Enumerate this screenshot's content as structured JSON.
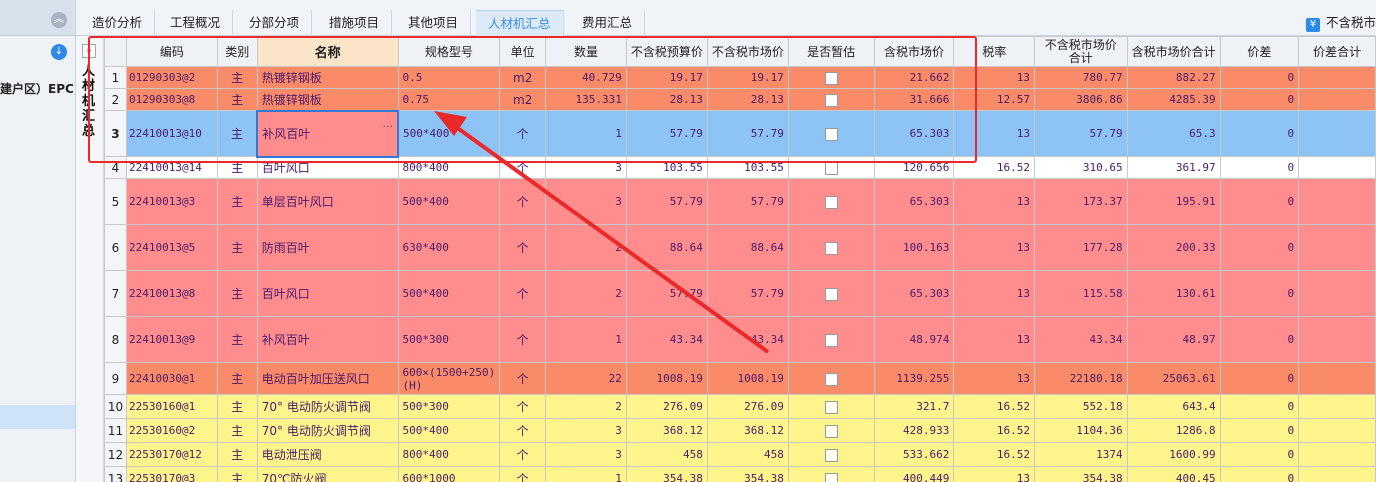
{
  "left": {
    "project_label": "建户区）EPC"
  },
  "tabs": [
    {
      "label": "造价分析"
    },
    {
      "label": "工程概况"
    },
    {
      "label": "分部分项"
    },
    {
      "label": "措施项目"
    },
    {
      "label": "其他项目"
    },
    {
      "label": "人材机汇总"
    },
    {
      "label": "费用汇总"
    }
  ],
  "tax_toggle_label": "不含税市",
  "side_label": "人材机汇总",
  "columns": [
    "编码",
    "类别",
    "名称",
    "规格型号",
    "单位",
    "数量",
    "不含税预算价",
    "不含税市场价",
    "是否暂估",
    "含税市场价",
    "税率",
    "不含税市场价合计",
    "含税市场价合计",
    "价差",
    "价差合计"
  ],
  "rows": [
    {
      "idx": "1",
      "code": "01290303@2",
      "type": "主",
      "name": "热镀锌钢板",
      "spec": "0.5",
      "unit": "m2",
      "qty": "40.729",
      "budget": "19.17",
      "market": "19.17",
      "tax_market": "21.662",
      "rate": "13",
      "total_ex": "780.77",
      "total_inc": "882.27",
      "diff": "0"
    },
    {
      "idx": "2",
      "code": "01290303@8",
      "type": "主",
      "name": "热镀锌钢板",
      "spec": "0.75",
      "unit": "m2",
      "qty": "135.331",
      "budget": "28.13",
      "market": "28.13",
      "tax_market": "31.666",
      "rate": "12.57",
      "total_ex": "3806.86",
      "total_inc": "4285.39",
      "diff": "0"
    },
    {
      "idx": "3",
      "code": "22410013@10",
      "type": "主",
      "name": "补风百叶",
      "spec": "500*400",
      "unit": "个",
      "qty": "1",
      "budget": "57.79",
      "market": "57.79",
      "tax_market": "65.303",
      "rate": "13",
      "total_ex": "57.79",
      "total_inc": "65.3",
      "diff": "0"
    },
    {
      "idx": "4",
      "code": "22410013@14",
      "type": "主",
      "name": "百叶风口",
      "spec": "800*400",
      "unit": "个",
      "qty": "3",
      "budget": "103.55",
      "market": "103.55",
      "tax_market": "120.656",
      "rate": "16.52",
      "total_ex": "310.65",
      "total_inc": "361.97",
      "diff": "0"
    },
    {
      "idx": "5",
      "code": "22410013@3",
      "type": "主",
      "name": "单层百叶风口",
      "spec": "500*400",
      "unit": "个",
      "qty": "3",
      "budget": "57.79",
      "market": "57.79",
      "tax_market": "65.303",
      "rate": "13",
      "total_ex": "173.37",
      "total_inc": "195.91",
      "diff": "0"
    },
    {
      "idx": "6",
      "code": "22410013@5",
      "type": "主",
      "name": "防雨百叶",
      "spec": "630*400",
      "unit": "个",
      "qty": "2",
      "budget": "88.64",
      "market": "88.64",
      "tax_market": "100.163",
      "rate": "13",
      "total_ex": "177.28",
      "total_inc": "200.33",
      "diff": "0"
    },
    {
      "idx": "7",
      "code": "22410013@8",
      "type": "主",
      "name": "百叶风口",
      "spec": "500*400",
      "unit": "个",
      "qty": "2",
      "budget": "57.79",
      "market": "57.79",
      "tax_market": "65.303",
      "rate": "13",
      "total_ex": "115.58",
      "total_inc": "130.61",
      "diff": "0"
    },
    {
      "idx": "8",
      "code": "22410013@9",
      "type": "主",
      "name": "补风百叶",
      "spec": "500*300",
      "unit": "个",
      "qty": "1",
      "budget": "43.34",
      "market": "43.34",
      "tax_market": "48.974",
      "rate": "13",
      "total_ex": "43.34",
      "total_inc": "48.97",
      "diff": "0"
    },
    {
      "idx": "9",
      "code": "22410030@1",
      "type": "主",
      "name": "电动百叶加压送风口",
      "spec": "600×(1500+250)(H)",
      "unit": "个",
      "qty": "22",
      "budget": "1008.19",
      "market": "1008.19",
      "tax_market": "1139.255",
      "rate": "13",
      "total_ex": "22180.18",
      "total_inc": "25063.61",
      "diff": "0"
    },
    {
      "idx": "10",
      "code": "22530160@1",
      "type": "主",
      "name": "70° 电动防火调节阀",
      "spec": "500*300",
      "unit": "个",
      "qty": "2",
      "budget": "276.09",
      "market": "276.09",
      "tax_market": "321.7",
      "rate": "16.52",
      "total_ex": "552.18",
      "total_inc": "643.4",
      "diff": "0"
    },
    {
      "idx": "11",
      "code": "22530160@2",
      "type": "主",
      "name": "70° 电动防火调节阀",
      "spec": "500*400",
      "unit": "个",
      "qty": "3",
      "budget": "368.12",
      "market": "368.12",
      "tax_market": "428.933",
      "rate": "16.52",
      "total_ex": "1104.36",
      "total_inc": "1286.8",
      "diff": "0"
    },
    {
      "idx": "12",
      "code": "22530170@12",
      "type": "主",
      "name": "电动泄压阀",
      "spec": "800*400",
      "unit": "个",
      "qty": "3",
      "budget": "458",
      "market": "458",
      "tax_market": "533.662",
      "rate": "16.52",
      "total_ex": "1374",
      "total_inc": "1600.99",
      "diff": "0"
    },
    {
      "idx": "13",
      "code": "22530170@3",
      "type": "主",
      "name": "70℃防火阀",
      "spec": "600*1000",
      "unit": "个",
      "qty": "1",
      "budget": "354.38",
      "market": "354.38",
      "tax_market": "400.449",
      "rate": "13",
      "total_ex": "354.38",
      "total_inc": "400.45",
      "diff": "0"
    }
  ],
  "colors": {
    "annotation": "#ea2a2a",
    "row_orange": "#f98b69",
    "row_pink": "#ff8d8d",
    "row_blue": "#8ec4f5",
    "row_yellow": "#fdf58c",
    "tab_active": "#3a8ee6"
  }
}
